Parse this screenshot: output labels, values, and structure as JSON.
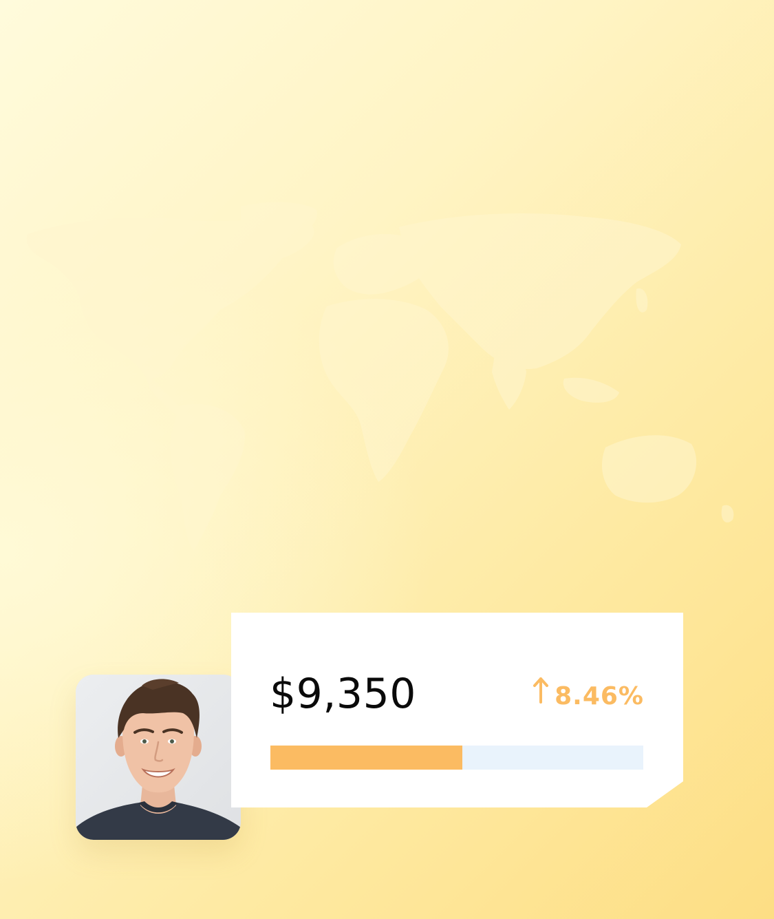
{
  "stats_card": {
    "amount": "$9,350",
    "change": "8.46%",
    "trend_icon": "arrow-up-icon",
    "progress_fraction": 0.514,
    "colors": {
      "accent": "#fbbb62",
      "track": "#e9f3fc",
      "amount_text": "#0a0a0a",
      "card_background": "#ffffff"
    }
  },
  "background": {
    "colors": {
      "start": "#fffbdc",
      "end": "#fdde84"
    },
    "decoration": "world-map"
  },
  "avatar": {
    "icon": "user-photo"
  }
}
